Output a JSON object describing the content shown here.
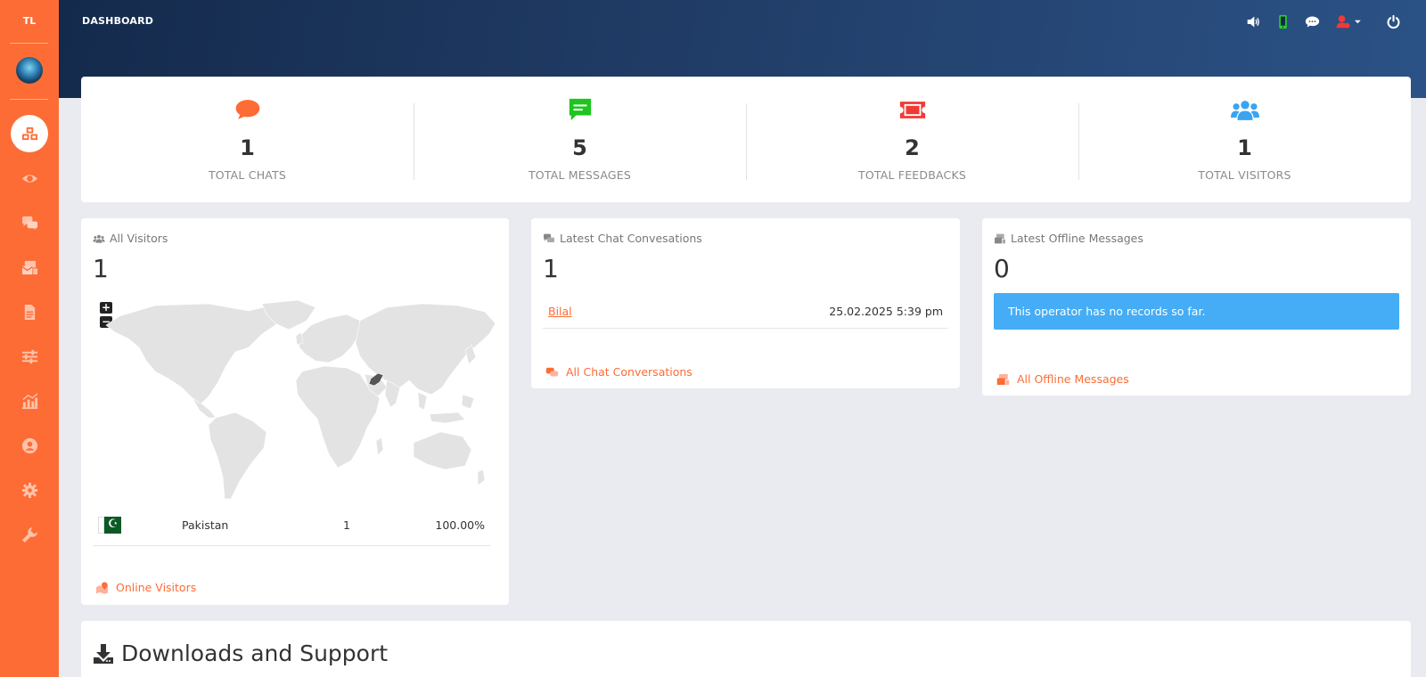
{
  "sidebar": {
    "logo": "TL",
    "items": [
      {
        "icon": "cubes-icon",
        "active": true
      },
      {
        "icon": "eye-icon"
      },
      {
        "icon": "comments-icon"
      },
      {
        "icon": "mail-bulk-icon"
      },
      {
        "icon": "document-icon"
      },
      {
        "icon": "sliders-icon"
      },
      {
        "icon": "chart-icon"
      },
      {
        "icon": "user-circle-icon"
      },
      {
        "icon": "gear-icon"
      },
      {
        "icon": "wrench-icon"
      }
    ]
  },
  "header": {
    "title": "DASHBOARD",
    "icons": [
      "volume-icon",
      "mobile-icon",
      "chat-bubble-icon",
      "user-status-icon",
      "power-icon"
    ]
  },
  "stats": [
    {
      "value": "1",
      "label": "TOTAL CHATS",
      "icon": "chat-bubble-icon",
      "color": "#fd6c35"
    },
    {
      "value": "5",
      "label": "TOTAL MESSAGES",
      "icon": "message-icon",
      "color": "#1ec51e"
    },
    {
      "value": "2",
      "label": "TOTAL FEEDBACKS",
      "icon": "ticket-icon",
      "color": "#f23a35"
    },
    {
      "value": "1",
      "label": "TOTAL VISITORS",
      "icon": "users-icon",
      "color": "#3aa3f2"
    }
  ],
  "visitors_panel": {
    "title": "All Visitors",
    "count": "1",
    "zoom_in": "+",
    "zoom_out": "−",
    "rows": [
      {
        "country": "Pakistan",
        "count": "1",
        "percent": "100.00%"
      }
    ],
    "link": "Online Visitors"
  },
  "chats_panel": {
    "title": "Latest Chat Convesations",
    "count": "1",
    "rows": [
      {
        "name": "Bilal",
        "date": "25.02.2025 5:39 pm"
      }
    ],
    "link": "All Chat Conversations"
  },
  "offline_panel": {
    "title": "Latest Offline Messages",
    "count": "0",
    "notice": "This operator has no records so far.",
    "link": "All Offline Messages"
  },
  "downloads": {
    "title": "Downloads and Support"
  },
  "colors": {
    "accent": "#fd6c35",
    "header_dark": "#142a4c",
    "info": "#44adf5"
  }
}
